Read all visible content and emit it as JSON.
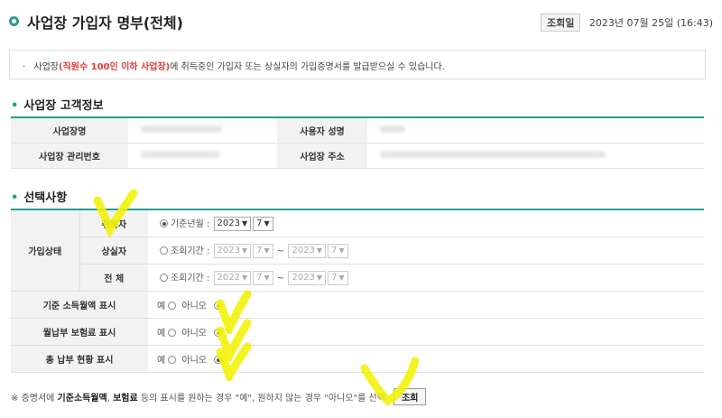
{
  "header": {
    "title": "사업장 가입자 명부(전체)",
    "query_date_label": "조회일",
    "query_date": "2023년 07월 25일 (16:43)"
  },
  "notice": {
    "prefix": "사업장",
    "highlight": "(직원수 100인 이하 사업장)",
    "suffix": "에 취득중인 가입자 또는 상실자의 가입증명서를 발급받으실 수 있습니다."
  },
  "customer_info": {
    "title": "사업장 고객정보",
    "labels": {
      "name": "사업장명",
      "user": "사용자 성명",
      "mgmt_no": "사업장 관리번호",
      "address": "사업장 주소"
    }
  },
  "options": {
    "title": "선택사항",
    "status_label": "가입상태",
    "acquired": {
      "label": "취득자",
      "radio_label": "기준년월 :",
      "year": "2023",
      "month": "7"
    },
    "lost": {
      "label": "상실자",
      "radio_label": "조회기간 :",
      "from_year": "2023",
      "from_month": "7",
      "to_year": "2023",
      "to_month": "7",
      "sep": "~"
    },
    "all": {
      "label": "전 체",
      "radio_label": "조회기간 :",
      "from_year": "2022",
      "from_month": "7",
      "to_year": "2023",
      "to_month": "7",
      "sep": "~"
    },
    "rows": [
      {
        "label": "기준 소득월액 표시",
        "yes": "예",
        "no": "아니오"
      },
      {
        "label": "월납부 보험료 표시",
        "yes": "예",
        "no": "아니오"
      },
      {
        "label": "총 납부 현황 표시",
        "yes": "예",
        "no": "아니오"
      }
    ]
  },
  "footnote": {
    "prefix": "※ 증명서에 ",
    "bold1": "기준소득월액",
    "sep": ", ",
    "bold2": "보험료",
    "suffix": " 등의 표시를 원하는 경우 \"예\", 원하지 않는 경우 \"아니오\"를 선택",
    "button": "조회"
  },
  "colors": {
    "accent": "#2a9d8f",
    "highlight": "#f2f20a",
    "notice_red": "#e03b3b"
  }
}
